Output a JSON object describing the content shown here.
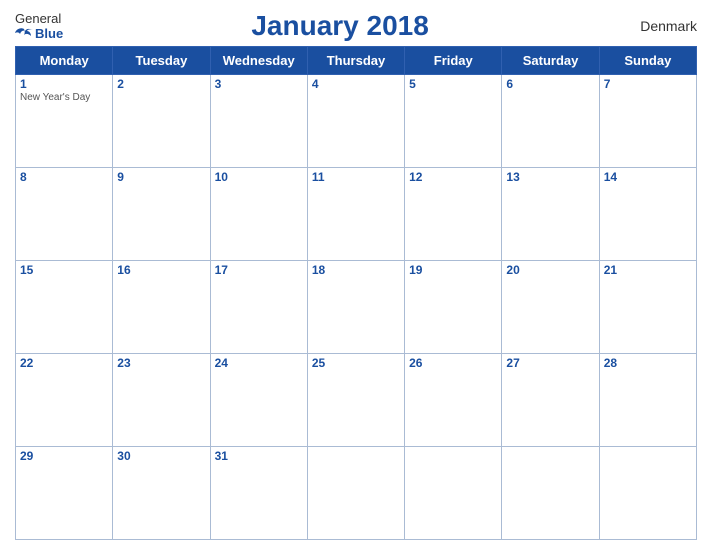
{
  "logo": {
    "general": "General",
    "blue": "Blue"
  },
  "title": "January 2018",
  "country": "Denmark",
  "weekdays": [
    "Monday",
    "Tuesday",
    "Wednesday",
    "Thursday",
    "Friday",
    "Saturday",
    "Sunday"
  ],
  "weeks": [
    [
      {
        "day": 1,
        "holiday": "New Year's Day"
      },
      {
        "day": 2,
        "holiday": ""
      },
      {
        "day": 3,
        "holiday": ""
      },
      {
        "day": 4,
        "holiday": ""
      },
      {
        "day": 5,
        "holiday": ""
      },
      {
        "day": 6,
        "holiday": ""
      },
      {
        "day": 7,
        "holiday": ""
      }
    ],
    [
      {
        "day": 8,
        "holiday": ""
      },
      {
        "day": 9,
        "holiday": ""
      },
      {
        "day": 10,
        "holiday": ""
      },
      {
        "day": 11,
        "holiday": ""
      },
      {
        "day": 12,
        "holiday": ""
      },
      {
        "day": 13,
        "holiday": ""
      },
      {
        "day": 14,
        "holiday": ""
      }
    ],
    [
      {
        "day": 15,
        "holiday": ""
      },
      {
        "day": 16,
        "holiday": ""
      },
      {
        "day": 17,
        "holiday": ""
      },
      {
        "day": 18,
        "holiday": ""
      },
      {
        "day": 19,
        "holiday": ""
      },
      {
        "day": 20,
        "holiday": ""
      },
      {
        "day": 21,
        "holiday": ""
      }
    ],
    [
      {
        "day": 22,
        "holiday": ""
      },
      {
        "day": 23,
        "holiday": ""
      },
      {
        "day": 24,
        "holiday": ""
      },
      {
        "day": 25,
        "holiday": ""
      },
      {
        "day": 26,
        "holiday": ""
      },
      {
        "day": 27,
        "holiday": ""
      },
      {
        "day": 28,
        "holiday": ""
      }
    ],
    [
      {
        "day": 29,
        "holiday": ""
      },
      {
        "day": 30,
        "holiday": ""
      },
      {
        "day": 31,
        "holiday": ""
      },
      {
        "day": null,
        "holiday": ""
      },
      {
        "day": null,
        "holiday": ""
      },
      {
        "day": null,
        "holiday": ""
      },
      {
        "day": null,
        "holiday": ""
      }
    ]
  ]
}
